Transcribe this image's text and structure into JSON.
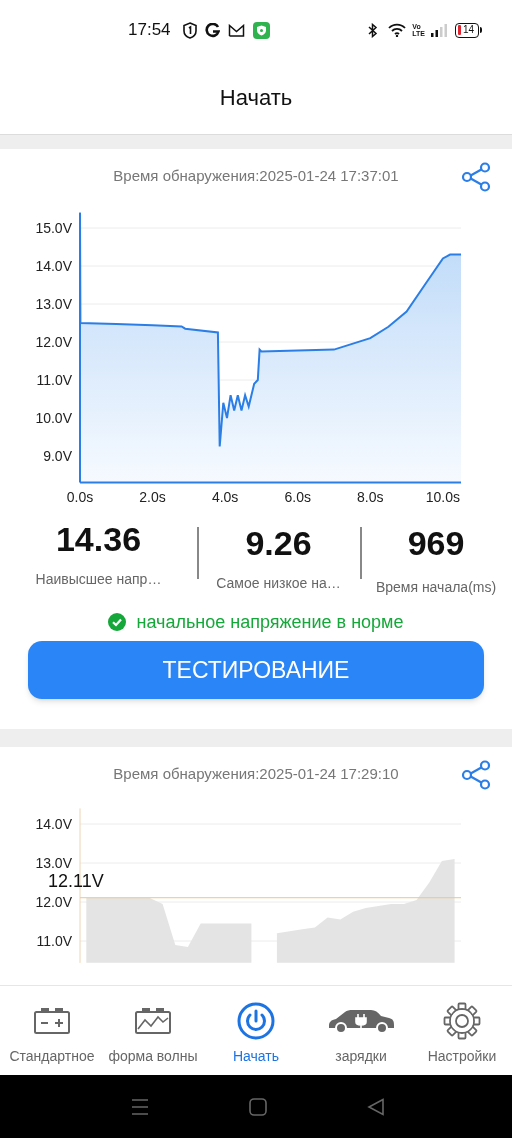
{
  "status_bar": {
    "time": "17:54",
    "volte": [
      "Vo",
      "LTE"
    ],
    "battery": "14"
  },
  "header": {
    "title": "Начать"
  },
  "records": [
    {
      "timestamp": "Время обнаружения:2025-01-24 17:37:01",
      "chart_data": {
        "type": "area",
        "xlim": [
          0,
          10.5
        ],
        "ylim": [
          8.3,
          15.4
        ],
        "xticks": [
          {
            "value": 0,
            "label": "0.0s"
          },
          {
            "value": 2,
            "label": "2.0s"
          },
          {
            "value": 4,
            "label": "4.0s"
          },
          {
            "value": 6,
            "label": "6.0s"
          },
          {
            "value": 8,
            "label": "8.0s"
          },
          {
            "value": 10,
            "label": "10.0s"
          }
        ],
        "yticks": [
          {
            "value": 9,
            "label": "9.0V"
          },
          {
            "value": 10,
            "label": "10.0V"
          },
          {
            "value": 11,
            "label": "11.0V"
          },
          {
            "value": 12,
            "label": "12.0V"
          },
          {
            "value": 13,
            "label": "13.0V"
          },
          {
            "value": 14,
            "label": "14.0V"
          },
          {
            "value": 15,
            "label": "15.0V"
          }
        ],
        "x": [
          0,
          0.01,
          1,
          2,
          2.8,
          2.9,
          3.8,
          3.85,
          3.95,
          4.05,
          4.15,
          4.25,
          4.35,
          4.45,
          4.55,
          4.65,
          4.8,
          4.9,
          4.95,
          5,
          6,
          7,
          8,
          8.5,
          9,
          9.5,
          10,
          10.2,
          10.5
        ],
        "grid": true,
        "series": [
          {
            "color": "#2b7ee6",
            "values": [
              15.4,
              12.5,
              12.47,
              12.44,
              12.41,
              12.35,
              12.25,
              9.25,
              10.4,
              10,
              10.6,
              10.2,
              10.6,
              10.2,
              10.6,
              10.3,
              10.9,
              11,
              11.8,
              11.75,
              11.78,
              11.8,
              12.1,
              12.4,
              12.8,
              13.5,
              14.2,
              14.3,
              14.3
            ]
          }
        ]
      },
      "stats": [
        {
          "value": "14.36",
          "label": "Наивысшее напр…"
        },
        {
          "value": "9.26",
          "label": "Самое низкое на…"
        },
        {
          "value": "969",
          "label": "Время начала(ms)"
        }
      ],
      "result": {
        "ok": true,
        "text": "начальное напряжение в норме"
      },
      "button": "ТЕСТИРОВАНИЕ"
    },
    {
      "timestamp": "Время обнаружения:2025-01-24 17:29:10",
      "chart_data": {
        "type": "area",
        "ylim": [
          10.44,
          14.4
        ],
        "yticks": [
          {
            "value": 11,
            "label": "11.0V"
          },
          {
            "value": 12,
            "label": "12.0V"
          },
          {
            "value": 13,
            "label": "13.0V"
          },
          {
            "value": 14,
            "label": "14.0V"
          }
        ],
        "grid": true,
        "series": [
          {
            "color": "#e4e4e4",
            "values": [
              12.1,
              12.1,
              12.1,
              12.1,
              12.1,
              12.1,
              11.95,
              10.9,
              10.85,
              11.45,
              11.45,
              11.45,
              11.45,
              11.45,
              null,
              11.2,
              11.25,
              11.3,
              11.35,
              11.6,
              11.55,
              11.75,
              11.85,
              11.9,
              11.95,
              11.95,
              12.05,
              12.5,
              13.05,
              13.1
            ]
          }
        ],
        "ref_lines": [
          {
            "axis": "y",
            "value": 12.11,
            "label": "12.11V",
            "color": "#f0c48a"
          }
        ]
      }
    }
  ],
  "nav": [
    {
      "label": "Стандартное",
      "selected": false
    },
    {
      "label": "форма волны",
      "selected": false
    },
    {
      "label": "Начать",
      "selected": true
    },
    {
      "label": "зарядки",
      "selected": false
    },
    {
      "label": "Настройки",
      "selected": false
    }
  ]
}
